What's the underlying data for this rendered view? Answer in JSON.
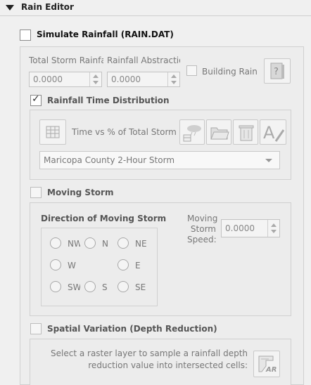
{
  "panel": {
    "title": "Rain Editor"
  },
  "simulate": {
    "label": "Simulate Rainfall  (RAIN.DAT)"
  },
  "fields": {
    "total_storm_label": "Total Storm Rainfa",
    "total_storm_value": "0.0000",
    "abstraction_label": "Rainfall Abstractior",
    "abstraction_value": "0.0000",
    "building_rain_label": "Building Rain"
  },
  "time_dist": {
    "label": "Rainfall Time Distribution",
    "checked": true,
    "table_label": "Time vs % of Total Storm",
    "storm_selected": "Maricopa County 2-Hour Storm"
  },
  "moving": {
    "label": "Moving Storm",
    "direction_title": "Direction of Moving Storm",
    "directions": [
      "NW",
      "N",
      "NE",
      "W",
      "E",
      "SW",
      "S",
      "SE"
    ],
    "speed_label_1": "Moving",
    "speed_label_2": "Storm",
    "speed_label_3": "Speed:",
    "speed_value": "0.0000"
  },
  "spatial": {
    "label": "Spatial Variation (Depth Reduction)",
    "desc_1": "Select a raster layer to sample a rainfall depth",
    "desc_2": "reduction value into intersected cells:",
    "icon_text": "AR"
  }
}
